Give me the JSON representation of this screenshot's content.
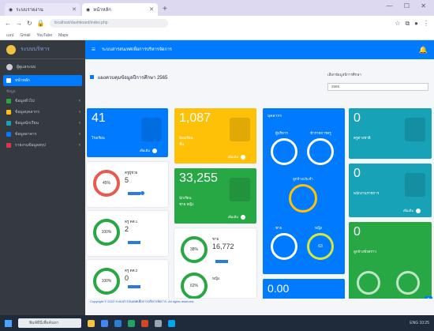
{
  "browser": {
    "tabs": [
      {
        "title": "ระบบรายงาน",
        "active": false
      },
      {
        "title": "หน้าหลัก",
        "active": true
      }
    ],
    "url": "localhost/dashboard/index.php",
    "window_controls": "—  ☐  ✕",
    "bookmarks": [
      "แอป",
      "Gmail",
      "YouTube",
      "Maps"
    ]
  },
  "sidebar": {
    "brand": "ระบบบริหาร",
    "user": "ผู้ดูแลระบบ",
    "items": [
      {
        "label": "หน้าหลัก",
        "active": true,
        "icon": "home-icon",
        "color": "#ffffff"
      },
      {
        "label": "ข้อมูลทั่วไป",
        "active": false,
        "icon": "list-icon",
        "color": "#28a745"
      },
      {
        "label": "ข้อมูลบุคลากร",
        "active": false,
        "icon": "user-icon",
        "color": "#ffc107"
      },
      {
        "label": "ข้อมูลนักเรียน",
        "active": false,
        "icon": "people-icon",
        "color": "#17a2b8"
      },
      {
        "label": "ข้อมูลอาคาร",
        "active": false,
        "icon": "building-icon",
        "color": "#007bff"
      },
      {
        "label": "รายงานข้อมูลสรุป",
        "active": false,
        "icon": "report-icon",
        "color": "#dc3545"
      }
    ],
    "section_header": "ข้อมูล"
  },
  "topnav": {
    "title": "ระบบสารสนเทศเพื่อการบริหารจัดการ",
    "menu_icon": "hamburger-icon",
    "bell_icon": "bell-icon"
  },
  "page": {
    "title": "แผงควบคุมข้อมูลปีการศึกษา 2565",
    "filter_label": "เลือกข้อมูลปีการศึกษา",
    "filter_value": "2565"
  },
  "cards": {
    "blue_top": {
      "value": "41",
      "label": "โรงเรียน",
      "more": "เพิ่มเติม"
    },
    "yellow": {
      "value": "1,087",
      "label": "ห้องเรียน",
      "label2": "ชั้น",
      "more": "เพิ่มเติม"
    },
    "green": {
      "value": "33,255",
      "label": "นักเรียน",
      "label2": "ชาย หญิง",
      "more": "เพิ่มเติม"
    },
    "teal1": {
      "value": "0",
      "label": "ครูต่างชาติ",
      "more": "เพิ่มเติม"
    },
    "teal2": {
      "value": "0",
      "label": "พนักงานราชการ",
      "more": "เพิ่มเติม"
    },
    "green_right": {
      "value": "0",
      "label": "ลูกจ้างชั่วคราว"
    },
    "blue_bottom": {
      "value": "0.00"
    }
  },
  "stats": {
    "ring1": {
      "percent": "45%",
      "label": "ครูผู้ช่วย",
      "value": "5"
    },
    "ring2": {
      "percent": "100%",
      "label": "ครู คศ.1",
      "value": "2"
    },
    "ring3": {
      "percent": "100%",
      "label": "ครู คศ.2",
      "value": "0"
    },
    "ring4": {
      "percent": "38%",
      "label": "ชาย",
      "value": "16,772"
    },
    "ring5": {
      "percent": "62%",
      "label": "หญิง",
      "value": ""
    }
  },
  "blue_panel": {
    "title": "บุคลากร",
    "r1": "ผู้บริหาร",
    "r2": "ข้าราชการครู",
    "r3": "ลูกจ้างประจำ",
    "r4": "ชาย",
    "r5": "หญิง",
    "r5_value": "63"
  },
  "footer": {
    "text": "Copyright © 2022 ระบบสารสนเทศเพื่อการบริหารจัดการ. All rights reserved."
  },
  "taskbar": {
    "search": "พิมพ์ที่นี่เพื่อค้นหา",
    "tray": "ENG 10:25"
  }
}
